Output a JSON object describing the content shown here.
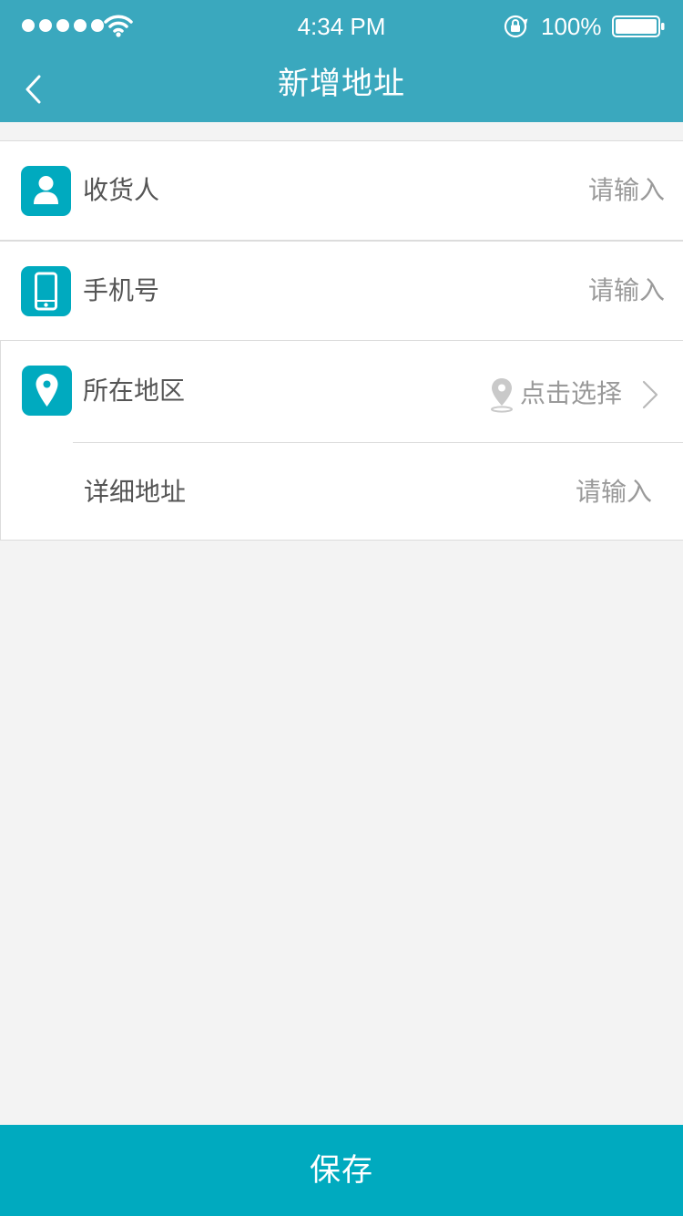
{
  "status_bar": {
    "time": "4:34 PM",
    "battery_percent": "100%",
    "signal_bars": 5
  },
  "nav": {
    "title": "新增地址",
    "back_icon": "chevron-left-icon"
  },
  "form": {
    "receiver": {
      "label": "收货人",
      "placeholder": "请输入",
      "value": "",
      "icon": "person-icon"
    },
    "phone": {
      "label": "手机号",
      "placeholder": "请输入",
      "value": "",
      "icon": "mobile-phone-icon"
    },
    "region": {
      "label": "所在地区",
      "action_text": "点击选择",
      "icon": "location-icon"
    },
    "address_detail": {
      "label": "详细地址",
      "placeholder": "请输入",
      "value": ""
    }
  },
  "footer": {
    "save_label": "保存"
  },
  "colors": {
    "nav_background": "#3aa8be",
    "accent": "#00aabf",
    "page_background": "#f3f3f3",
    "label_text": "#555555",
    "placeholder_text": "#9a9a9a"
  }
}
